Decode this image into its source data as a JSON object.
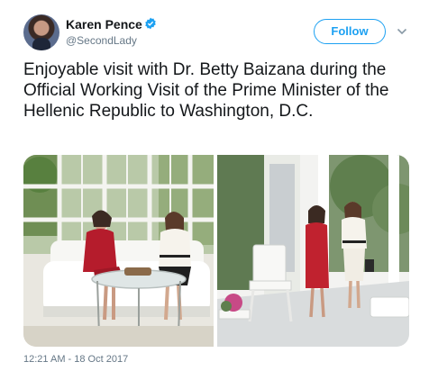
{
  "tweet": {
    "author": {
      "name": "Karen Pence",
      "handle": "@SecondLady",
      "verified": true,
      "avatar_icon": "profile-avatar"
    },
    "follow_label": "Follow",
    "menu_icon": "chevron-down-icon",
    "text": "Enjoyable visit with Dr. Betty Baizana during the Official Working Visit of the Prime Minister of the Hellenic Republic to Washington, D.C.",
    "timestamp": "12:21 AM - 18 Oct 2017"
  },
  "colors": {
    "accent": "#1da1f2",
    "secondary_text": "#657786",
    "primary_text": "#14171a"
  }
}
